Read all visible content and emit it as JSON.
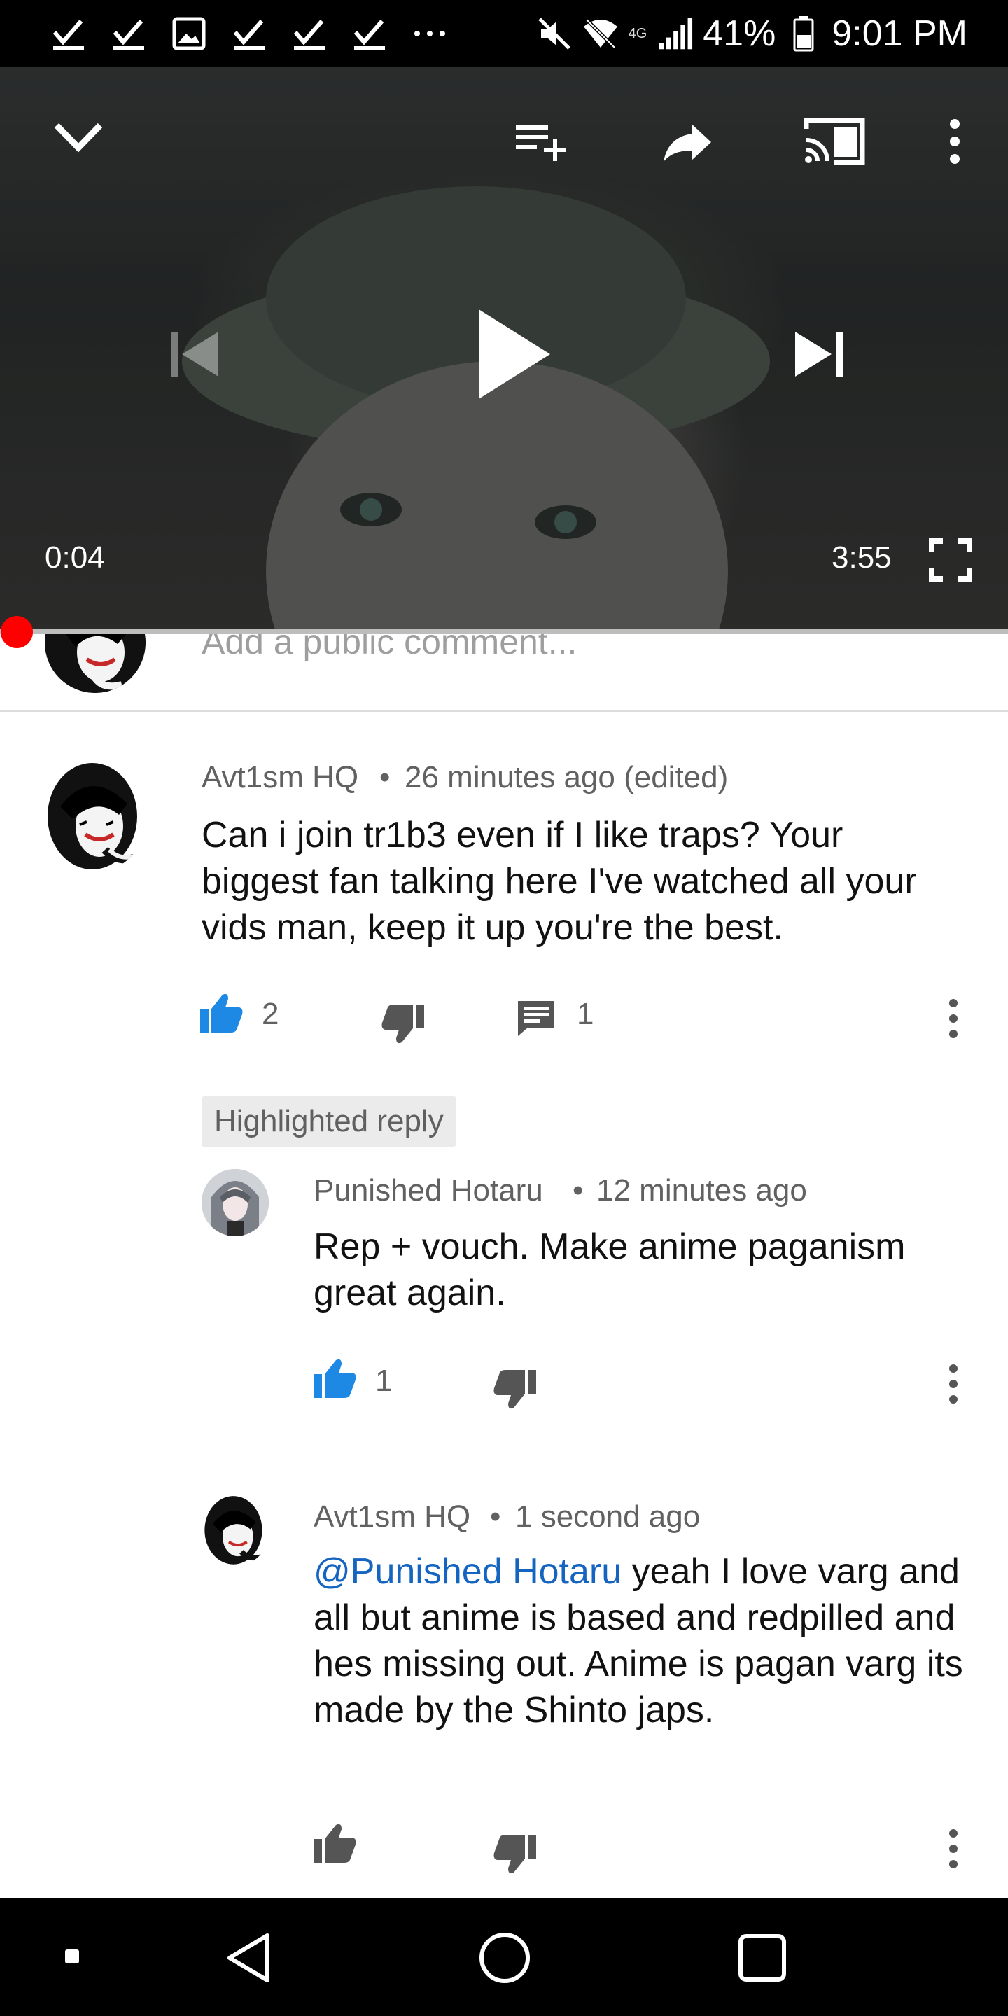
{
  "status_bar": {
    "network": "4G",
    "battery": "41%",
    "time": "9:01 PM",
    "icons": [
      "check-icon",
      "check-icon",
      "image-icon",
      "check-icon",
      "check-icon",
      "check-icon",
      "more-horiz-icon",
      "mute-icon",
      "wifi-icon",
      "signal-icon",
      "battery-icon"
    ]
  },
  "player": {
    "elapsed": "0:04",
    "duration": "3:55",
    "progress_fraction": 0.017,
    "icons": [
      "collapse-icon",
      "add-to-queue-icon",
      "share-icon",
      "cast-icon",
      "more-vert-icon",
      "previous-icon",
      "play-icon",
      "next-icon",
      "fullscreen-icon"
    ]
  },
  "comment_box": {
    "placeholder": "Add a public comment..."
  },
  "comments": [
    {
      "author": "Avt1sm HQ",
      "time": "26 minutes ago (edited)",
      "text": "Can i join tr1b3 even if I like traps? Your biggest fan talking here I've watched all your vids man, keep it up you're the best.",
      "likes": "2",
      "replies": "1"
    }
  ],
  "replies": {
    "chip": "Highlighted reply",
    "items": [
      {
        "author": "Punished Hotaru",
        "time": "12 minutes ago",
        "text": "Rep + vouch. Make anime paganism great again.",
        "likes": "1"
      },
      {
        "author": "Avt1sm HQ",
        "time": "1 second ago",
        "mention": "@Punished Hotaru",
        "text": " yeah I love varg and all but anime is based and redpilled and hes missing out. Anime is pagan varg its made by the Shinto japs."
      }
    ]
  },
  "colors": {
    "accent_blue": "#1e88e5",
    "progress_red": "#ff0000",
    "meta_gray": "#616161"
  }
}
